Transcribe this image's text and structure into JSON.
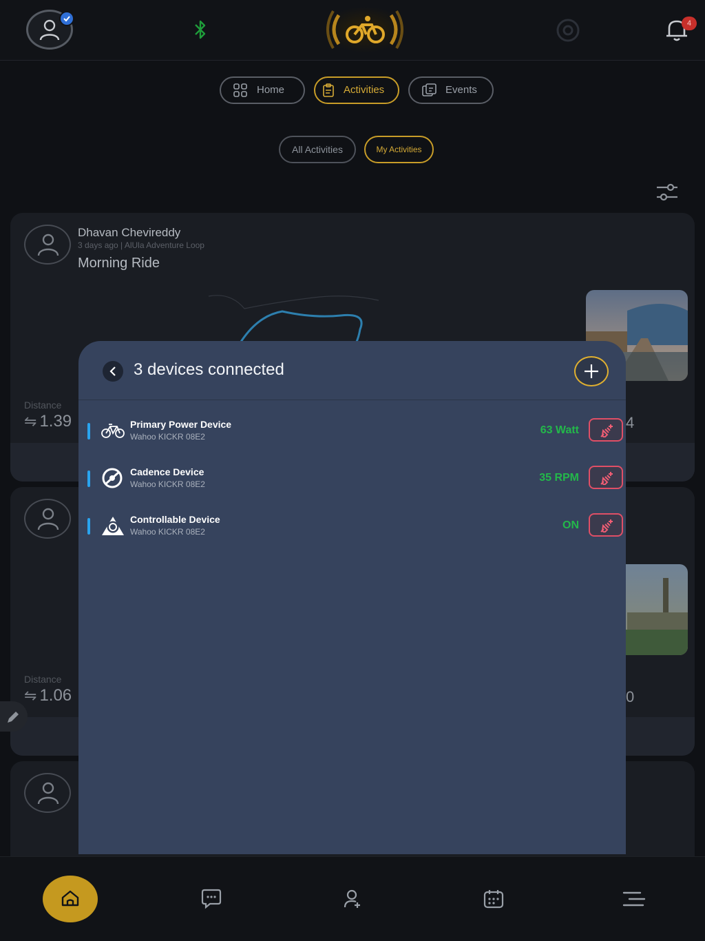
{
  "header": {
    "notification_count": "4",
    "accent_color": "#c89d28",
    "icons": [
      "user-icon",
      "bluetooth-icon",
      "bike-logo",
      "sync-icon",
      "bell-icon"
    ]
  },
  "tabs": [
    {
      "label": "Home",
      "active": false
    },
    {
      "label": "Activities",
      "active": true
    },
    {
      "label": "Events",
      "active": false
    }
  ],
  "subtabs": [
    {
      "label": "All Activities",
      "active": false
    },
    {
      "label": "My Activities",
      "active": true
    }
  ],
  "feed": [
    {
      "user": "Dhavan Chevireddy",
      "meta": "3 days ago | AlUla Adventure Loop",
      "title": "Morning Ride",
      "stat_label": "Distance",
      "stat_value": "1.39",
      "peek_value": "4"
    },
    {
      "stat_label": "Distance",
      "stat_value": "1.06",
      "peek_value": "0"
    }
  ],
  "devices_modal": {
    "title": "3 devices connected",
    "devices": [
      {
        "name": "Primary Power Device",
        "model": "Wahoo KICKR 08E2",
        "value": "63 Watt",
        "icon": "bike-icon"
      },
      {
        "name": "Cadence Device",
        "model": "Wahoo KICKR 08E2",
        "value": "35 RPM",
        "icon": "cadence-icon"
      },
      {
        "name": "Controllable Device",
        "model": "Wahoo KICKR 08E2",
        "value": "ON",
        "icon": "trainer-icon"
      }
    ],
    "value_color": "#23b84a",
    "disconnect_color": "#e04f66"
  },
  "bottom_nav": [
    "home-icon",
    "chat-icon",
    "add-friend-icon",
    "calendar-icon",
    "menu-icon"
  ]
}
